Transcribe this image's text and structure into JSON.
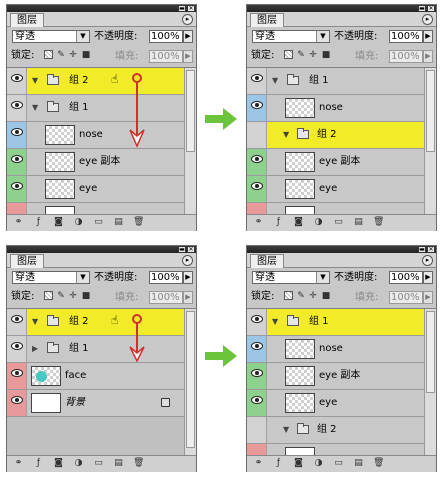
{
  "panel": {
    "tab_label": "图层",
    "blend_mode": "穿透",
    "opacity_label": "不透明度:",
    "opacity_value": "100%",
    "lock_label": "锁定:",
    "fill_label": "填充:",
    "fill_value": "100%"
  },
  "panels": [
    {
      "layers": [
        {
          "name": "组 2",
          "kind": "group",
          "selected": true,
          "expanded": true,
          "indent": 0,
          "eye": "gray"
        },
        {
          "name": "组 1",
          "kind": "group",
          "selected": false,
          "expanded": true,
          "indent": 0,
          "eye": "gray"
        },
        {
          "name": "nose",
          "kind": "layer",
          "selected": false,
          "indent": 1,
          "eye": "blue"
        },
        {
          "name": "eye 副本",
          "kind": "layer",
          "selected": false,
          "indent": 1,
          "eye": "green"
        },
        {
          "name": "eye",
          "kind": "layer",
          "selected": false,
          "indent": 1,
          "eye": "green"
        }
      ]
    },
    {
      "layers": [
        {
          "name": "组 1",
          "kind": "group",
          "selected": false,
          "expanded": true,
          "indent": 0,
          "eye": "gray"
        },
        {
          "name": "nose",
          "kind": "layer",
          "selected": false,
          "indent": 1,
          "eye": "blue"
        },
        {
          "name": "组 2",
          "kind": "group",
          "selected": true,
          "expanded": true,
          "indent": 1,
          "eye": "gray"
        },
        {
          "name": "eye 副本",
          "kind": "layer",
          "selected": false,
          "indent": 1,
          "eye": "green"
        },
        {
          "name": "eye",
          "kind": "layer",
          "selected": false,
          "indent": 1,
          "eye": "green"
        }
      ]
    },
    {
      "layers": [
        {
          "name": "组 2",
          "kind": "group",
          "selected": true,
          "expanded": true,
          "indent": 0,
          "eye": "gray"
        },
        {
          "name": "组 1",
          "kind": "group",
          "selected": false,
          "expanded": false,
          "indent": 0,
          "eye": "gray"
        },
        {
          "name": "face",
          "kind": "face",
          "selected": false,
          "indent": 0,
          "eye": "red"
        },
        {
          "name": "背景",
          "kind": "background",
          "selected": false,
          "indent": 0,
          "eye": "red"
        }
      ]
    },
    {
      "layers": [
        {
          "name": "组 1",
          "kind": "group",
          "selected": true,
          "expanded": true,
          "indent": 0,
          "eye": "gray"
        },
        {
          "name": "nose",
          "kind": "layer",
          "selected": false,
          "indent": 1,
          "eye": "blue"
        },
        {
          "name": "eye 副本",
          "kind": "layer",
          "selected": false,
          "indent": 1,
          "eye": "green"
        },
        {
          "name": "eye",
          "kind": "layer",
          "selected": false,
          "indent": 1,
          "eye": "green"
        },
        {
          "name": "组 2",
          "kind": "group",
          "selected": false,
          "expanded": true,
          "indent": 1,
          "eye": "gray"
        }
      ]
    }
  ],
  "colors": {
    "selected_row": "#f1ec27",
    "drag_arrow": "#d22f2f",
    "step_arrow": "#6cc33c"
  }
}
